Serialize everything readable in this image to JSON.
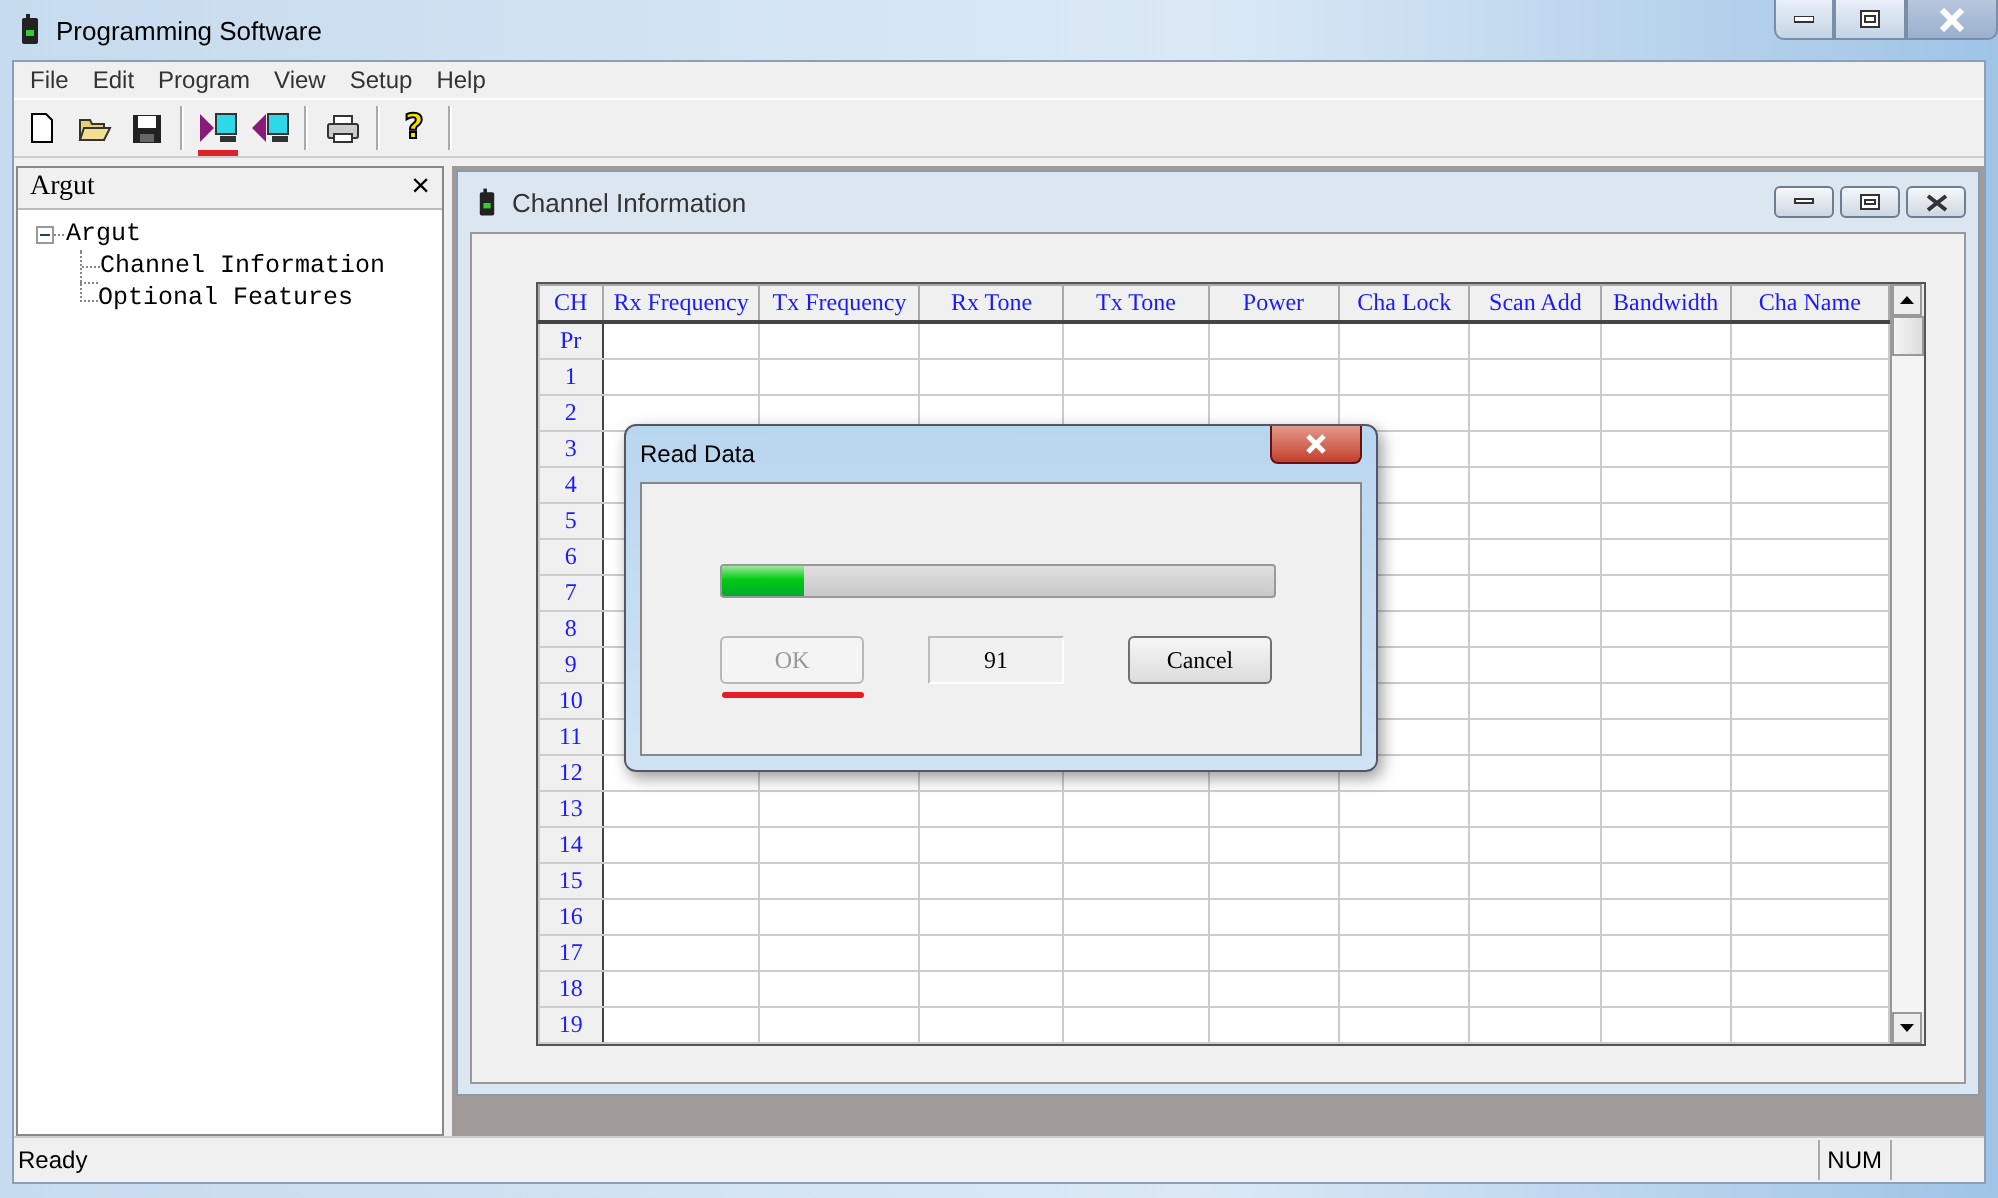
{
  "window": {
    "title": "Programming Software"
  },
  "menu": [
    "File",
    "Edit",
    "Program",
    "View",
    "Setup",
    "Help"
  ],
  "toolbar": [
    {
      "kind": "new",
      "marked": false
    },
    {
      "kind": "open",
      "marked": false
    },
    {
      "kind": "save",
      "marked": false
    },
    {
      "kind": "separator"
    },
    {
      "kind": "read",
      "marked": true
    },
    {
      "kind": "write",
      "marked": false
    },
    {
      "kind": "separator"
    },
    {
      "kind": "print",
      "marked": false
    },
    {
      "kind": "separator"
    },
    {
      "kind": "help",
      "glyph": "?",
      "marked": false
    }
  ],
  "sidebar": {
    "title": "Argut",
    "close": "×",
    "tree": [
      {
        "label": "Argut",
        "expanded": true,
        "children": [
          {
            "label": "Channel Information"
          },
          {
            "label": "Optional Features"
          }
        ]
      }
    ]
  },
  "child_window": {
    "title": "Channel Information"
  },
  "table": {
    "columns": [
      "CH",
      "Rx Frequency",
      "Tx Frequency",
      "Rx Tone",
      "Tx Tone",
      "Power",
      "Cha Lock",
      "Scan Add",
      "Bandwidth",
      "Cha Name"
    ],
    "rows": [
      "Pr",
      "1",
      "2",
      "3",
      "4",
      "5",
      "6",
      "7",
      "8",
      "9",
      "10",
      "11",
      "12",
      "13",
      "14",
      "15",
      "16",
      "17",
      "18",
      "19"
    ]
  },
  "dialog": {
    "title": "Read Data",
    "level": 0.15,
    "ok": {
      "label": "OK",
      "disabled": true,
      "marked": true
    },
    "count": "91",
    "cancel": {
      "label": "Cancel",
      "disabled": false
    }
  },
  "status_bar": {
    "text": "Ready",
    "num": "NUM"
  }
}
